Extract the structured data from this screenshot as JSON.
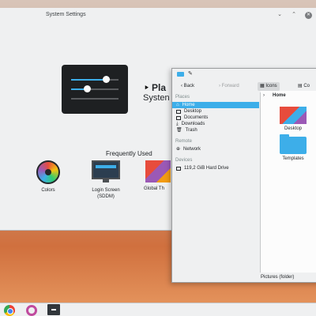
{
  "settings": {
    "title": "System Settings",
    "hero_title": "Pla",
    "hero_subtitle": "Systen",
    "frequently_used_label": "Frequently Used",
    "items": [
      {
        "label": "Colors"
      },
      {
        "label": "Login Screen (SDDM)"
      },
      {
        "label": "Global Th"
      }
    ]
  },
  "file_manager": {
    "toolbar": {
      "back": "Back",
      "forward": "Forward",
      "icons": "Icons",
      "compact": "Co"
    },
    "sections": {
      "places": "Places",
      "remote": "Remote",
      "devices": "Devices"
    },
    "places": [
      "Home",
      "Desktop",
      "Documents",
      "Downloads",
      "Trash"
    ],
    "remote": [
      "Network"
    ],
    "devices": [
      "119,2 GiB Hard Drive"
    ],
    "breadcrumb": "Home",
    "files": [
      {
        "name": "Desktop"
      },
      {
        "name": "Templates"
      }
    ],
    "status": "Pictures (folder)"
  },
  "colors": {
    "accent": "#3daee9",
    "window_bg": "#eff0f1"
  }
}
